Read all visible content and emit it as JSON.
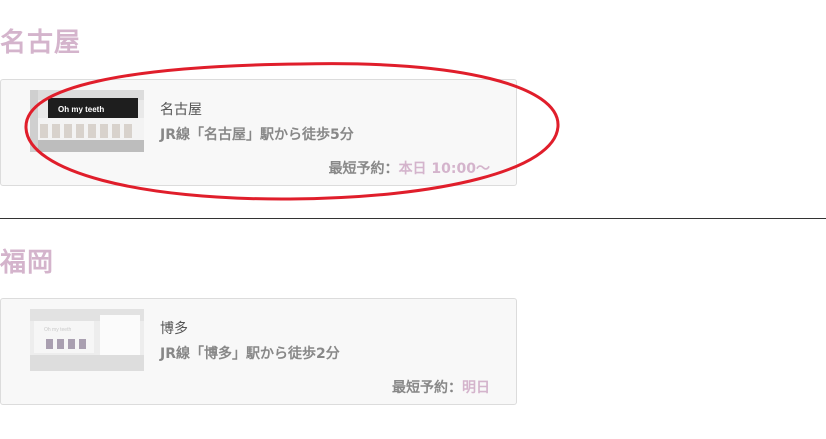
{
  "sections": [
    {
      "title": "名古屋",
      "clinic": {
        "name": "名古屋",
        "access": "JR線「名古屋」駅から徒歩5分",
        "reserve_label": "最短予約：",
        "reserve_value": "本日 10:00〜",
        "photo_sign_text": "Oh my teeth"
      }
    },
    {
      "title": "福岡",
      "clinic": {
        "name": "博多",
        "access": "JR線「博多」駅から徒歩2分",
        "reserve_label": "最短予約：",
        "reserve_value": "明日",
        "photo_sign_text": "Oh my teeth"
      }
    }
  ],
  "colors": {
    "accent": "#d4b4cc",
    "annotation": "#e01e2b"
  }
}
